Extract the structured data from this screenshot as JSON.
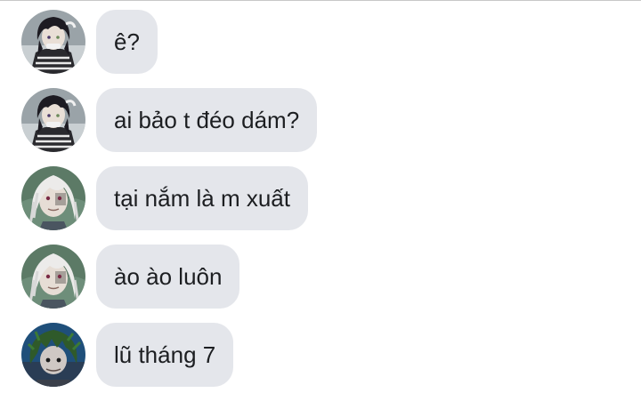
{
  "conversation": {
    "messages": [
      {
        "text": "ê?",
        "avatar": "sender-dark-hair-avatar"
      },
      {
        "text": "ai bảo t đéo dám?",
        "avatar": "sender-dark-hair-avatar"
      },
      {
        "text": "tại nắm là m xuất",
        "avatar": "sender-white-hair-avatar"
      },
      {
        "text": "ào ào luôn",
        "avatar": "sender-white-hair-avatar"
      },
      {
        "text": "lũ tháng 7",
        "avatar": "sender-green-hair-avatar"
      }
    ]
  },
  "colors": {
    "bubble": "#e4e6eb",
    "text": "#1c1e21",
    "background": "#ffffff"
  }
}
